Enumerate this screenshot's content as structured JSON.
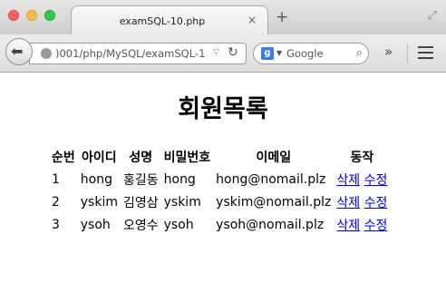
{
  "browser": {
    "tab_title": "examSQL-10.php",
    "tab_close": "×",
    "new_tab": "+",
    "url": ")001/php/MySQL/examSQL-1",
    "search_engine": "Google",
    "search_engine_letter": "g",
    "icons": {
      "back": "back-arrow-icon",
      "site": "globe-icon",
      "url_dropdown": "chevron-down-icon",
      "reload": "reload-icon",
      "search": "search-icon",
      "overflow": "overflow-chevron-icon",
      "menu": "hamburger-menu-icon",
      "fullscreen": "fullscreen-icon"
    }
  },
  "page": {
    "title": "회원목록",
    "table": {
      "headers": [
        "순번",
        "아이디",
        "성명",
        "비밀번호",
        "이메일",
        "동작"
      ],
      "rows": [
        {
          "no": "1",
          "id": "hong",
          "name": "홍길동",
          "password": "hong",
          "email": "hong@nomail.plz",
          "delete": "삭제",
          "edit": "수정"
        },
        {
          "no": "2",
          "id": "yskim",
          "name": "김영삼",
          "password": "yskim",
          "email": "yskim@nomail.plz",
          "delete": "삭제",
          "edit": "수정"
        },
        {
          "no": "3",
          "id": "ysoh",
          "name": "오영수",
          "password": "ysoh",
          "email": "ysoh@nomail.plz",
          "delete": "삭제",
          "edit": "수정"
        }
      ]
    }
  },
  "colors": {
    "link": "#0000ee",
    "traffic_close": "#fc615d",
    "traffic_minimize": "#fdbc40",
    "traffic_maximize": "#34c84a"
  }
}
